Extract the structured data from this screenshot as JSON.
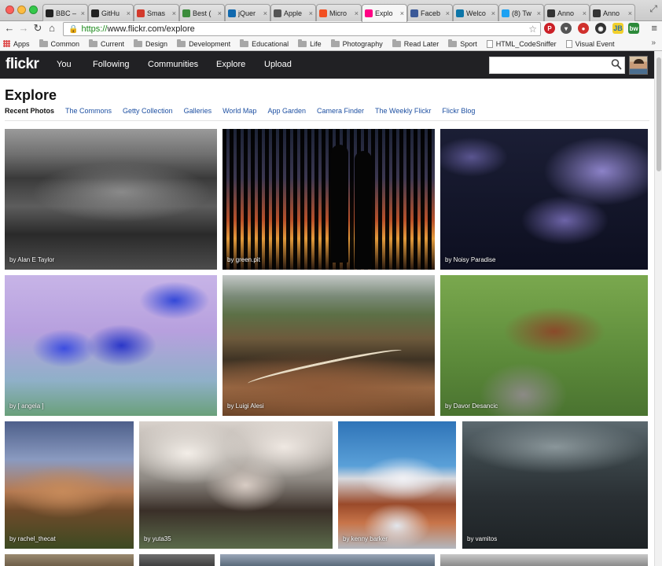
{
  "browser": {
    "tabs": [
      {
        "label": "BBC – ",
        "icon": "bbc-icon",
        "color": "#222222"
      },
      {
        "label": "GitHu",
        "icon": "github-icon",
        "color": "#222222"
      },
      {
        "label": "Smas",
        "icon": "smashing-icon",
        "color": "#d33a2c"
      },
      {
        "label": "Best (",
        "icon": "best-icon",
        "color": "#3c8c3c"
      },
      {
        "label": "jQuer",
        "icon": "jquery-icon",
        "color": "#1169ae"
      },
      {
        "label": "Apple",
        "icon": "apple-icon",
        "color": "#555555"
      },
      {
        "label": "Micro",
        "icon": "microsoft-icon",
        "color": "#f25022"
      },
      {
        "label": "Explo",
        "icon": "flickr-icon",
        "color": "#ff0084",
        "active": true
      },
      {
        "label": "Faceb",
        "icon": "facebook-icon",
        "color": "#3b5998"
      },
      {
        "label": "Welco",
        "icon": "linkedin-icon",
        "color": "#0e76a8"
      },
      {
        "label": "(8) Tw",
        "icon": "twitter-icon",
        "color": "#1da1f2"
      },
      {
        "label": "Anno",
        "icon": "annotate-icon",
        "color": "#333333"
      },
      {
        "label": "Anno",
        "icon": "annotate-icon",
        "color": "#333333"
      }
    ],
    "url_scheme": "https://",
    "url_rest": "www.flickr.com/explore",
    "bookmarks": [
      {
        "label": "Apps",
        "type": "apps"
      },
      {
        "label": "Common",
        "type": "folder"
      },
      {
        "label": "Current",
        "type": "folder"
      },
      {
        "label": "Design",
        "type": "folder"
      },
      {
        "label": "Development",
        "type": "folder"
      },
      {
        "label": "Educational",
        "type": "folder"
      },
      {
        "label": "Life",
        "type": "folder"
      },
      {
        "label": "Photography",
        "type": "folder"
      },
      {
        "label": "Read Later",
        "type": "folder"
      },
      {
        "label": "Sport",
        "type": "folder"
      },
      {
        "label": "HTML_CodeSniffer",
        "type": "page"
      },
      {
        "label": "Visual Event",
        "type": "page"
      }
    ],
    "extensions": [
      {
        "name": "pinterest-icon",
        "color": "#cb2027",
        "text": "P"
      },
      {
        "name": "pocket-icon",
        "color": "#555555",
        "text": "▾"
      },
      {
        "name": "adblock-icon",
        "color": "#d0312d",
        "text": "●"
      },
      {
        "name": "vimeo-icon",
        "color": "#333333",
        "text": "◉"
      },
      {
        "name": "chrome-ext-icon",
        "color": "#2b7bb9",
        "text": "◉"
      }
    ],
    "ext_jb": "JB",
    "ext_bw": "bw"
  },
  "flickr": {
    "logo": "flickr",
    "nav": [
      "You",
      "Following",
      "Communities",
      "Explore",
      "Upload"
    ],
    "search_placeholder": "",
    "page_title": "Explore",
    "subnav": [
      "Recent Photos",
      "The Commons",
      "Getty Collection",
      "Galleries",
      "World Map",
      "App Garden",
      "Camera Finder",
      "The Weekly Flickr",
      "Flickr Blog"
    ],
    "photos": [
      {
        "credit": "by Alan E Taylor"
      },
      {
        "credit": "by green.pit"
      },
      {
        "credit": "by Noisy Paradise"
      },
      {
        "credit": "by [ angela ]"
      },
      {
        "credit": "by Luigi Alesi"
      },
      {
        "credit": "by Davor Desancic"
      },
      {
        "credit": "by rachel_thecat"
      },
      {
        "credit": "by yuta35"
      },
      {
        "credit": "by kenny barker"
      },
      {
        "credit": "by vamitos"
      }
    ]
  }
}
